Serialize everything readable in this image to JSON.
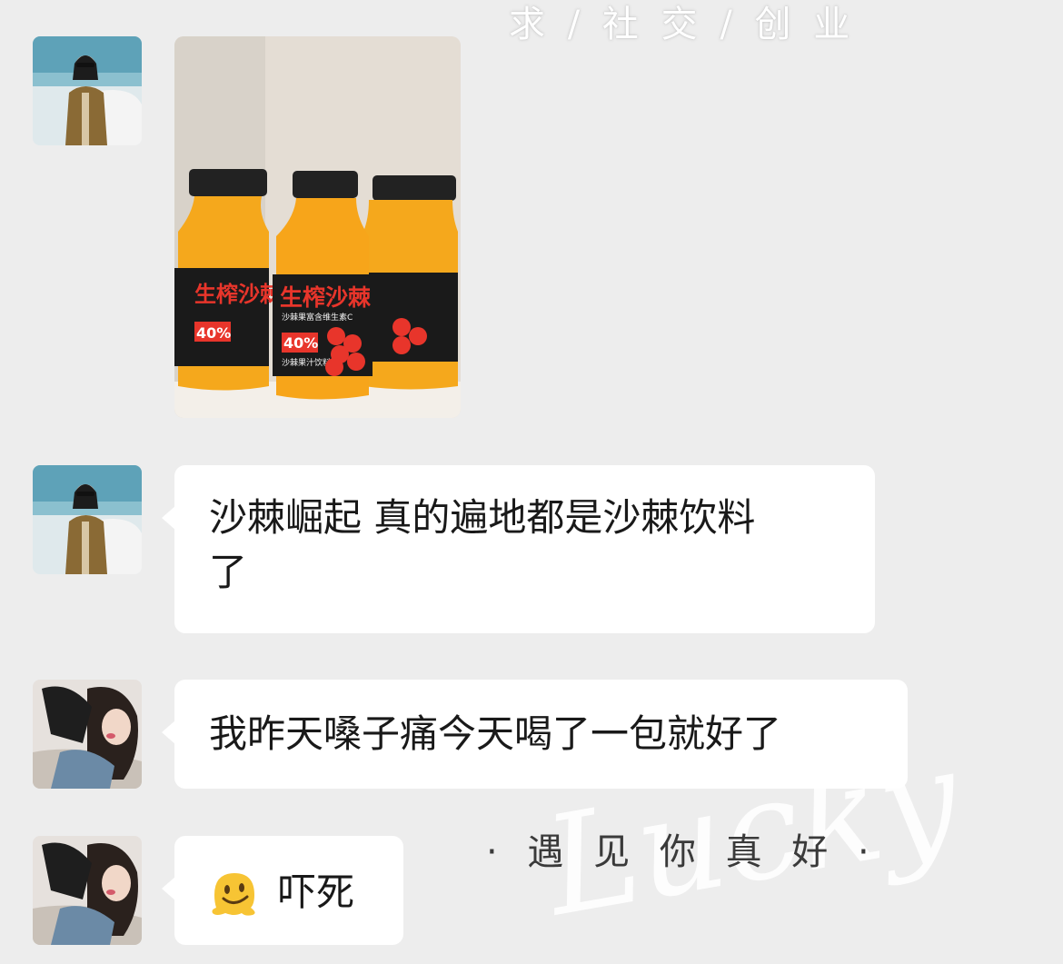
{
  "watermark": {
    "top": "求 / 社 交 / 创 业",
    "script": "Lucky",
    "bottom": "· 遇 见 你 真 好 ·"
  },
  "photo": {
    "brand": "生榨沙棘",
    "subtitle": "沙棘果富含维生素C",
    "badge": "40%",
    "label": "沙棘果汁饮料"
  },
  "messages": [
    {
      "sender": "user-a",
      "type": "image"
    },
    {
      "sender": "user-a",
      "line1": "沙棘崛起 真的遍地都是沙棘饮料",
      "line2": "了"
    },
    {
      "sender": "user-b",
      "text": "我昨天嗓子痛今天喝了一包就好了"
    },
    {
      "sender": "user-b",
      "emoji": "melting-face",
      "text": "吓死"
    }
  ],
  "colors": {
    "background": "#ededed",
    "bubble": "#ffffff",
    "juice": "#f5a81c",
    "label": "#1a1a1a",
    "brand_text": "#e8352b"
  }
}
